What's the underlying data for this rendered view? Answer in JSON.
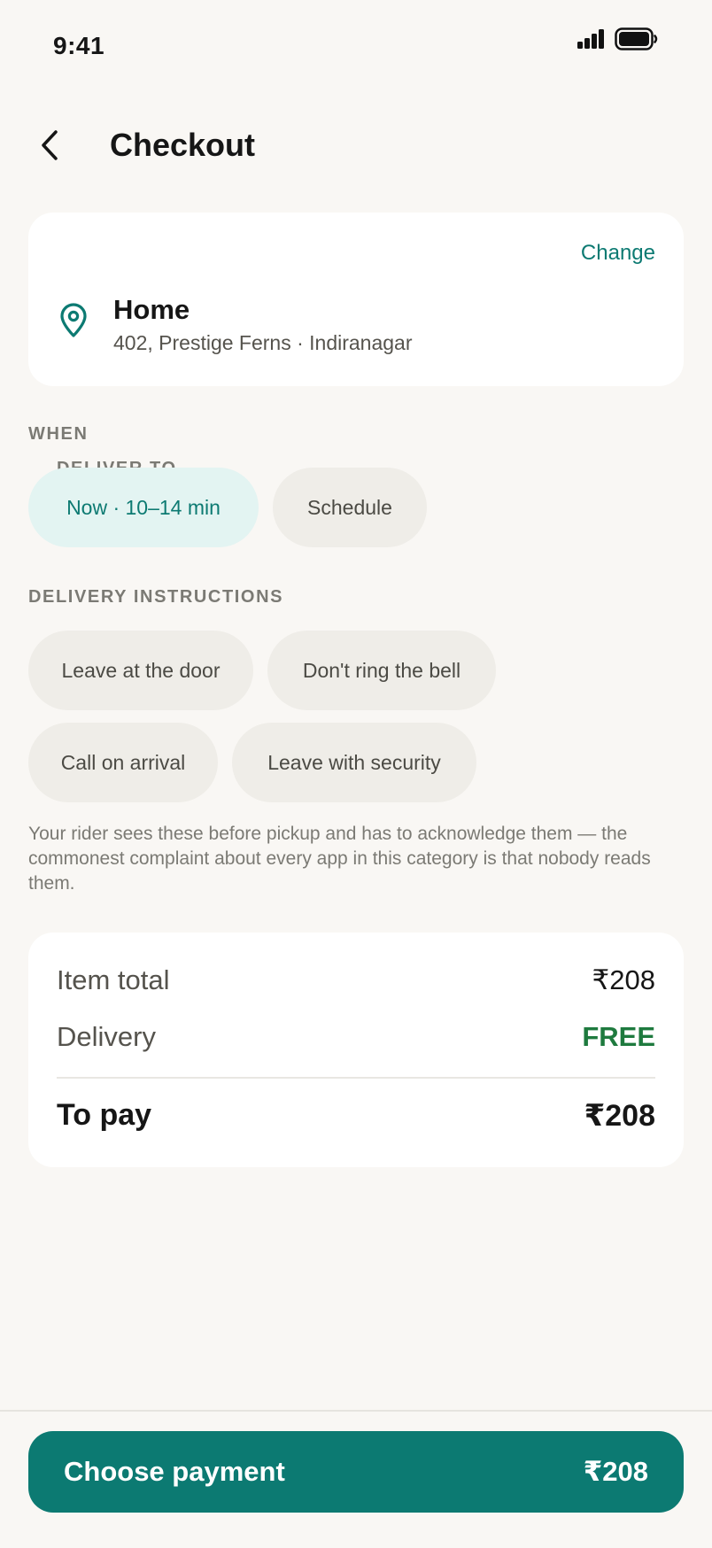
{
  "status_bar": {
    "time": "9:41"
  },
  "header": {
    "title": "Checkout"
  },
  "address": {
    "section_label": "DELIVER TO",
    "change_label": "Change",
    "name": "Home",
    "line": "402, Prestige Ferns · Indiranagar"
  },
  "when": {
    "section_label": "WHEN",
    "options": [
      {
        "label": "Now · 10–14 min",
        "selected": true
      },
      {
        "label": "Schedule",
        "selected": false
      }
    ]
  },
  "instructions": {
    "section_label": "DELIVERY INSTRUCTIONS",
    "chips": [
      {
        "label": "Leave at the door"
      },
      {
        "label": "Don't ring the bell"
      },
      {
        "label": "Call on arrival"
      },
      {
        "label": "Leave with security"
      }
    ],
    "note": "Your rider sees these before pickup and has to acknowledge them — the commonest complaint about every app in this category is that nobody reads them."
  },
  "summary": {
    "item_total_label": "Item total",
    "item_total_value": "₹208",
    "delivery_label": "Delivery",
    "delivery_value": "FREE",
    "to_pay_label": "To pay",
    "to_pay_value": "₹208"
  },
  "footer": {
    "pay_label": "Choose payment",
    "pay_amount": "₹208"
  },
  "colors": {
    "accent": "#0c7a72",
    "selected_chip_bg": "#e3f4f2",
    "chip_bg": "#efede8",
    "free": "#1e7a3e",
    "background": "#f9f7f4"
  },
  "icons": {
    "back": "chevron-left-icon",
    "location": "map-pin-icon",
    "signal": "cellular-signal-icon",
    "battery": "battery-icon"
  }
}
